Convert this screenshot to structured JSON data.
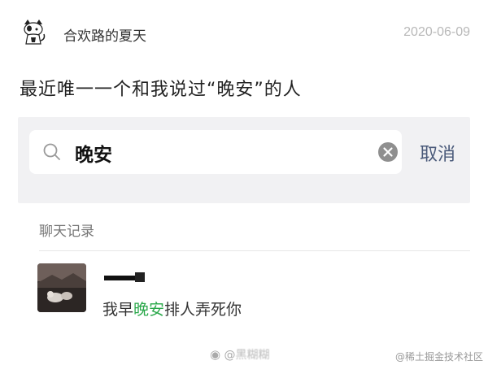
{
  "post": {
    "username": "合欢路的夏天",
    "date": "2020-06-09",
    "text": "最近唯一一个和我说过“晚安”的人"
  },
  "search": {
    "query": "晚安",
    "cancel_label": "取消"
  },
  "section": {
    "label": "聊天记录"
  },
  "result": {
    "text_before": "我早",
    "text_highlight": "晚安",
    "text_after": "排人弄死你",
    "highlight_color": "#2aa84a"
  },
  "watermarks": {
    "weibo_prefix": "@",
    "weibo_name": "黑糊糊",
    "juejin": "@稀土掘金技术社区"
  },
  "icons": {
    "avatar": "cat-avatar-icon",
    "search": "search-icon",
    "clear": "clear-icon"
  }
}
